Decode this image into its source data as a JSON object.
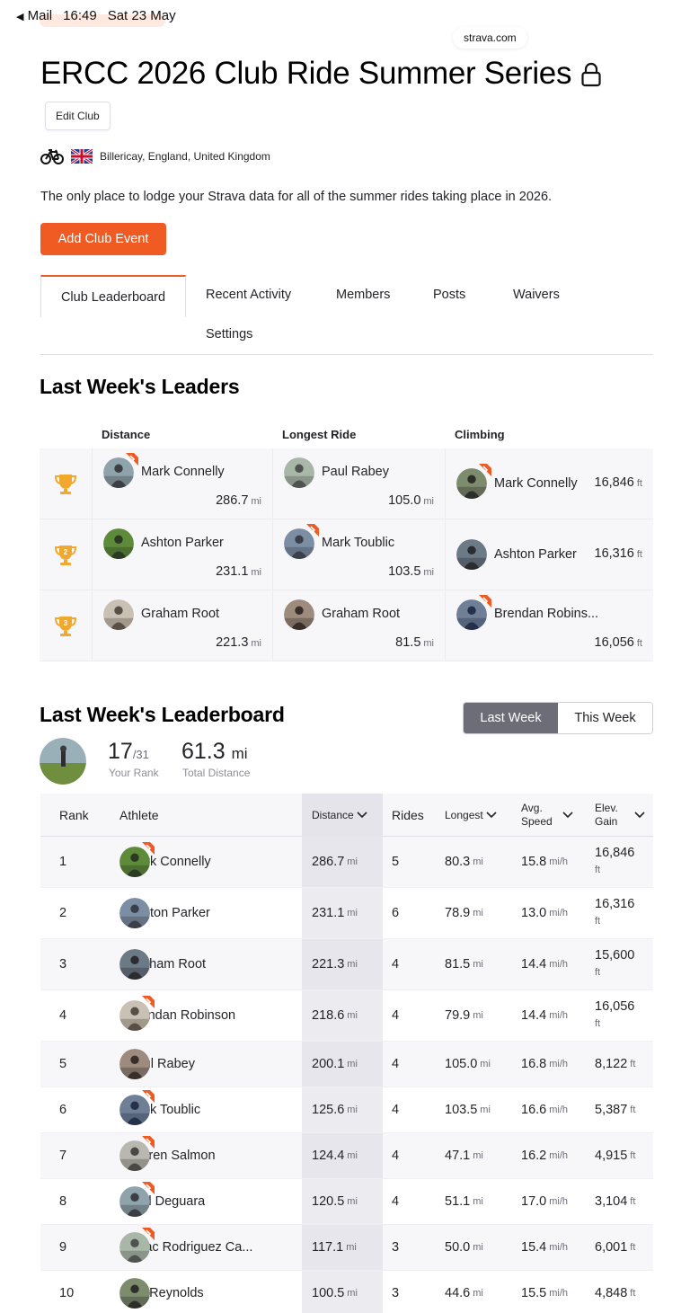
{
  "status_bar": {
    "back_app": "Mail",
    "time": "16:49",
    "date": "Sat 23 May",
    "url": "strava.com"
  },
  "club": {
    "title": "ERCC 2026 Club Ride Summer Series",
    "edit_label": "Edit Club",
    "location": "Billericay, England, United Kingdom",
    "description": "The only place to lodge your Strava data for all of the summer rides taking place in 2026.",
    "add_event_label": "Add Club Event"
  },
  "tabs": [
    "Club Leaderboard",
    "Recent Activity",
    "Members",
    "Posts",
    "Waivers",
    "Settings"
  ],
  "leaders": {
    "title": "Last Week's Leaders",
    "columns": [
      "Distance",
      "Longest Ride",
      "Climbing"
    ],
    "rows": [
      {
        "place": "1",
        "distance": {
          "name": "Mark Connelly",
          "value": "286.7",
          "unit": "mi",
          "badge": true
        },
        "longest": {
          "name": "Paul Rabey",
          "value": "105.0",
          "unit": "mi",
          "badge": false
        },
        "climbing": {
          "name": "Mark Connelly",
          "value": "16,846",
          "unit": "ft",
          "badge": true
        }
      },
      {
        "place": "2",
        "distance": {
          "name": "Ashton Parker",
          "value": "231.1",
          "unit": "mi",
          "badge": false
        },
        "longest": {
          "name": "Mark Toublic",
          "value": "103.5",
          "unit": "mi",
          "badge": true
        },
        "climbing": {
          "name": "Ashton Parker",
          "value": "16,316",
          "unit": "ft",
          "badge": false
        }
      },
      {
        "place": "3",
        "distance": {
          "name": "Graham Root",
          "value": "221.3",
          "unit": "mi",
          "badge": false
        },
        "longest": {
          "name": "Graham Root",
          "value": "81.5",
          "unit": "mi",
          "badge": false
        },
        "climbing": {
          "name": "Brendan Robins...",
          "value": "16,056",
          "unit": "ft",
          "badge": true
        }
      }
    ]
  },
  "leaderboard": {
    "title": "Last Week's Leaderboard",
    "toggle": {
      "last_week": "Last Week",
      "this_week": "This Week"
    },
    "your_rank": "17",
    "rank_total": "/31",
    "your_rank_label": "Your Rank",
    "total_distance": "61.3",
    "total_distance_unit": "mi",
    "total_distance_label": "Total Distance",
    "headers": {
      "rank": "Rank",
      "athlete": "Athlete",
      "distance": "Distance",
      "rides": "Rides",
      "longest": "Longest",
      "avg_speed": "Avg. Speed",
      "elev_gain": "Elev. Gain"
    },
    "units": {
      "distance": "mi",
      "speed": "mi/h",
      "elev": "ft"
    },
    "rows": [
      {
        "rank": "1",
        "athlete": "Mark Connelly",
        "distance": "286.7",
        "rides": "5",
        "longest": "80.3",
        "speed": "15.8",
        "elev": "16,846",
        "badge": true
      },
      {
        "rank": "2",
        "athlete": "Ashton Parker",
        "distance": "231.1",
        "rides": "6",
        "longest": "78.9",
        "speed": "13.0",
        "elev": "16,316",
        "badge": false
      },
      {
        "rank": "3",
        "athlete": "Graham Root",
        "distance": "221.3",
        "rides": "4",
        "longest": "81.5",
        "speed": "14.4",
        "elev": "15,600",
        "badge": false
      },
      {
        "rank": "4",
        "athlete": "Brendan Robinson",
        "distance": "218.6",
        "rides": "4",
        "longest": "79.9",
        "speed": "14.4",
        "elev": "16,056",
        "badge": true
      },
      {
        "rank": "5",
        "athlete": "Paul Rabey",
        "distance": "200.1",
        "rides": "4",
        "longest": "105.0",
        "speed": "16.8",
        "elev": "8,122",
        "badge": false
      },
      {
        "rank": "6",
        "athlete": "Mark Toublic",
        "distance": "125.6",
        "rides": "4",
        "longest": "103.5",
        "speed": "16.6",
        "elev": "5,387",
        "badge": true
      },
      {
        "rank": "7",
        "athlete": "Darren Salmon",
        "distance": "124.4",
        "rides": "4",
        "longest": "47.1",
        "speed": "16.2",
        "elev": "4,915",
        "badge": true
      },
      {
        "rank": "8",
        "athlete": "Carl Deguara",
        "distance": "120.5",
        "rides": "4",
        "longest": "51.1",
        "speed": "17.0",
        "elev": "3,104",
        "badge": true
      },
      {
        "rank": "9",
        "athlete": "Isaac Rodriguez Ca...",
        "distance": "117.1",
        "rides": "3",
        "longest": "50.0",
        "speed": "15.4",
        "elev": "6,001",
        "badge": true
      },
      {
        "rank": "10",
        "athlete": "Ian Reynolds",
        "distance": "100.5",
        "rides": "3",
        "longest": "44.6",
        "speed": "15.5",
        "elev": "4,848",
        "badge": false
      }
    ]
  },
  "colors": {
    "accent": "#f05a23",
    "trophy": "#f0a92e",
    "toggle_active": "#6d6d78"
  }
}
